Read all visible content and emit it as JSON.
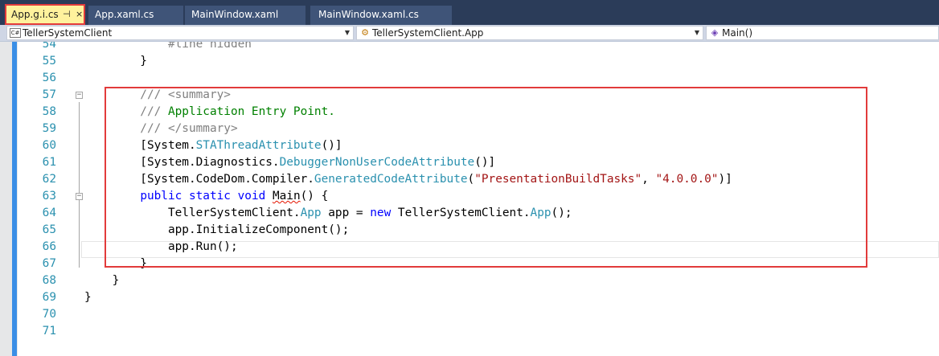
{
  "tabs": [
    {
      "label": "App.g.i.cs",
      "active": true
    },
    {
      "label": "App.xaml.cs",
      "active": false
    },
    {
      "label": "MainWindow.xaml",
      "active": false
    },
    {
      "label": "MainWindow.xaml.cs",
      "active": false
    }
  ],
  "tab_pin_glyph": "⊣",
  "tab_close_glyph": "×",
  "navbar": {
    "project": {
      "icon": "C#",
      "label": "TellerSystemClient"
    },
    "type": {
      "icon": "class-icon",
      "label": "TellerSystemClient.App"
    },
    "member": {
      "icon": "method-icon",
      "label": "Main()"
    }
  },
  "editor": {
    "lines": [
      {
        "num": "54",
        "parts": [
          {
            "t": "            #line hidden",
            "c": "comment"
          }
        ]
      },
      {
        "num": "55",
        "parts": [
          {
            "t": "        }",
            "c": "plain"
          }
        ]
      },
      {
        "num": "56",
        "parts": [
          {
            "t": "",
            "c": "plain"
          }
        ]
      },
      {
        "num": "57",
        "parts": [
          {
            "t": "        /// <summary>",
            "c": "comment"
          }
        ]
      },
      {
        "num": "58",
        "parts": [
          {
            "t": "        /// ",
            "c": "comment"
          },
          {
            "t": "Application Entry Point.",
            "c": "green"
          }
        ]
      },
      {
        "num": "59",
        "parts": [
          {
            "t": "        /// </summary>",
            "c": "comment"
          }
        ]
      },
      {
        "num": "60",
        "parts": [
          {
            "t": "        [System.",
            "c": "plain"
          },
          {
            "t": "STAThreadAttribute",
            "c": "type"
          },
          {
            "t": "()]",
            "c": "plain"
          }
        ]
      },
      {
        "num": "61",
        "parts": [
          {
            "t": "        [System.Diagnostics.",
            "c": "plain"
          },
          {
            "t": "DebuggerNonUserCodeAttribute",
            "c": "type"
          },
          {
            "t": "()]",
            "c": "plain"
          }
        ]
      },
      {
        "num": "62",
        "parts": [
          {
            "t": "        [System.CodeDom.Compiler.",
            "c": "plain"
          },
          {
            "t": "GeneratedCodeAttribute",
            "c": "type"
          },
          {
            "t": "(",
            "c": "plain"
          },
          {
            "t": "\"PresentationBuildTasks\"",
            "c": "string"
          },
          {
            "t": ", ",
            "c": "plain"
          },
          {
            "t": "\"4.0.0.0\"",
            "c": "string"
          },
          {
            "t": ")]",
            "c": "plain"
          }
        ]
      },
      {
        "num": "63",
        "parts": [
          {
            "t": "        ",
            "c": "plain"
          },
          {
            "t": "public",
            "c": "keyword"
          },
          {
            "t": " ",
            "c": "plain"
          },
          {
            "t": "static",
            "c": "keyword"
          },
          {
            "t": " ",
            "c": "plain"
          },
          {
            "t": "void",
            "c": "keyword"
          },
          {
            "t": " ",
            "c": "plain"
          },
          {
            "t": "Main",
            "c": "squiggle"
          },
          {
            "t": "() {",
            "c": "plain"
          }
        ]
      },
      {
        "num": "64",
        "parts": [
          {
            "t": "            TellerSystemClient.",
            "c": "plain"
          },
          {
            "t": "App",
            "c": "type"
          },
          {
            "t": " app = ",
            "c": "plain"
          },
          {
            "t": "new",
            "c": "keyword"
          },
          {
            "t": " TellerSystemClient.",
            "c": "plain"
          },
          {
            "t": "App",
            "c": "type"
          },
          {
            "t": "();",
            "c": "plain"
          }
        ]
      },
      {
        "num": "65",
        "parts": [
          {
            "t": "            app.InitializeComponent();",
            "c": "plain"
          }
        ]
      },
      {
        "num": "66",
        "parts": [
          {
            "t": "            app.Run();",
            "c": "plain"
          }
        ]
      },
      {
        "num": "67",
        "parts": [
          {
            "t": "        }",
            "c": "plain"
          }
        ]
      },
      {
        "num": "68",
        "parts": [
          {
            "t": "    }",
            "c": "plain"
          }
        ]
      },
      {
        "num": "69",
        "parts": [
          {
            "t": "}",
            "c": "plain"
          }
        ]
      },
      {
        "num": "70",
        "parts": [
          {
            "t": "",
            "c": "plain"
          }
        ]
      },
      {
        "num": "71",
        "parts": [
          {
            "t": "",
            "c": "plain"
          }
        ]
      }
    ]
  },
  "colors": {
    "tab_strip": "#2b3c59",
    "active_tab": "#fff29d",
    "highlight_box": "#e23b3b",
    "line_number": "#2b91af",
    "keyword": "#0000ff",
    "type": "#2b91af",
    "string": "#a31515",
    "comment": "#808080",
    "doc_text": "#008000"
  }
}
